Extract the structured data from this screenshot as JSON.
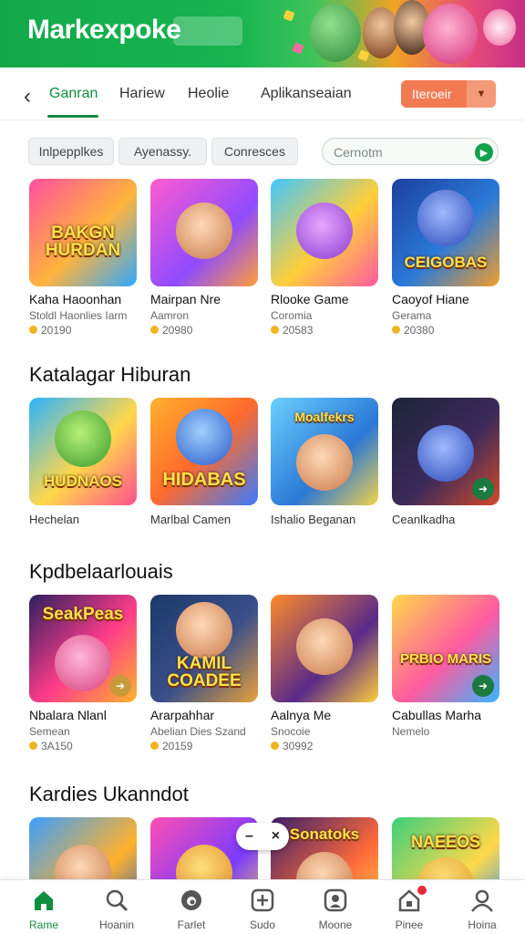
{
  "app": {
    "brand": "Markexpoke"
  },
  "tabs": {
    "items": [
      {
        "label": "Ganran",
        "active": true
      },
      {
        "label": "Hariew",
        "active": false
      },
      {
        "label": "Heolie",
        "active": false
      },
      {
        "label": "Aplikanseaian",
        "active": false
      }
    ],
    "dropdown_label": "Iteroeir"
  },
  "filters": {
    "chips": [
      "Inlpepplkes",
      "Ayenassy.",
      "Conresces"
    ],
    "search_placeholder": "Cernotm"
  },
  "sections": [
    {
      "title": "",
      "cards": [
        {
          "name": "Kaha Haoonhan",
          "sub": "Stoldl Haonlies Iarm",
          "rating": "20190",
          "logo": "BAKGN HURDAN"
        },
        {
          "name": "Mairpan Nre",
          "sub": "Aamron",
          "rating": "20980",
          "logo": ""
        },
        {
          "name": "Rlooke Game",
          "sub": "Coromia",
          "rating": "20583",
          "logo": ""
        },
        {
          "name": "Caoyof Hiane",
          "sub": "Gerama",
          "rating": "20380",
          "logo": "CEIGOBAS"
        }
      ]
    },
    {
      "title": "Katalagar Hiburan",
      "cards": [
        {
          "name": "Hechelan",
          "logo": "HUDNAOS"
        },
        {
          "name": "Marlbal Camen",
          "logo": "HIDABAS"
        },
        {
          "name": "Ishalio Beganan",
          "logo": "Moalfekrs"
        },
        {
          "name": "Ceanlkadha",
          "logo": ""
        }
      ]
    },
    {
      "title": "Kpdbelaarlouais",
      "cards": [
        {
          "name": "Nbalara Nlanl",
          "sub": "Semean",
          "rating": "3A150",
          "logo": "SeakPeas"
        },
        {
          "name": "Ararpahhar",
          "sub": "Abelian Dies Szand",
          "rating": "20159",
          "logo": "KAMIL COADEE"
        },
        {
          "name": "Aalnya Me",
          "sub": "Snocoie",
          "rating": "30992",
          "logo": ""
        },
        {
          "name": "Cabullas Marha",
          "sub": "Nemelo",
          "rating": "",
          "logo": "PRBIO MARIS"
        }
      ]
    },
    {
      "title": "Kardies Ukanndot",
      "cards": [
        {
          "logo": ""
        },
        {
          "logo": ""
        },
        {
          "logo": "Sonatoks"
        },
        {
          "logo": "NAEEOS"
        }
      ]
    }
  ],
  "fab": {
    "minus": "–",
    "close": "×"
  },
  "bottom_nav": [
    {
      "label": "Rame",
      "icon": "home-icon",
      "active": true
    },
    {
      "label": "Hoanin",
      "icon": "search-icon",
      "active": false
    },
    {
      "label": "Farlet",
      "icon": "wallet-icon",
      "active": false
    },
    {
      "label": "Sudo",
      "icon": "plus-box-icon",
      "active": false
    },
    {
      "label": "Moone",
      "icon": "gamepad-icon",
      "active": false
    },
    {
      "label": "Pinee",
      "icon": "bell-house-icon",
      "active": false,
      "badge": true
    },
    {
      "label": "Hoina",
      "icon": "profile-icon",
      "active": false
    }
  ],
  "colors": {
    "brand_green": "#0f8e40",
    "accent_orange": "#f27a52",
    "badge_red": "#e8293a"
  }
}
